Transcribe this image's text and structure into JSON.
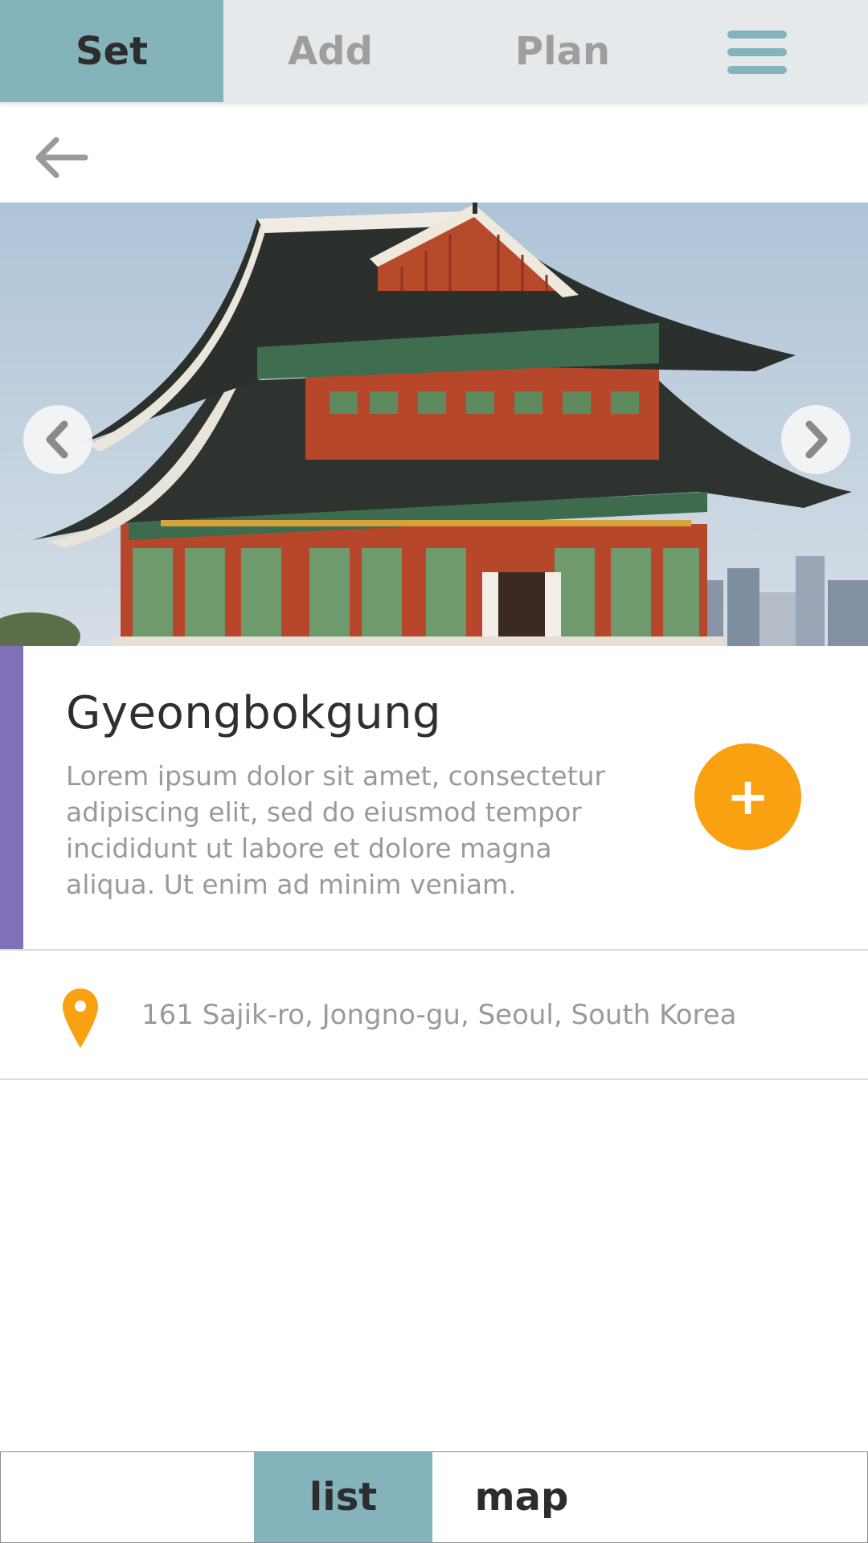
{
  "tabs": {
    "set": "Set",
    "add": "Add",
    "plan": "Plan"
  },
  "icons": {
    "menu": "hamburger-menu-icon",
    "back": "arrow-left-icon",
    "prev": "chevron-left-icon",
    "next": "chevron-right-icon",
    "add": "plus-icon",
    "location": "map-pin-icon"
  },
  "place": {
    "title": "Gyeongbokgung",
    "description": "Lorem ipsum dolor sit amet, consectetur adipiscing elit, sed do eiusmod tempor incididunt ut labore et dolore magna aliqua. Ut enim ad minim veniam.",
    "address": "161 Sajik-ro, Jongno-gu, Seoul, South Korea",
    "add_label": "+"
  },
  "view_toggle": {
    "list": "list",
    "map": "map",
    "selected": "list"
  },
  "colors": {
    "accent_teal": "#84b3bb",
    "accent_purple": "#8070b8",
    "accent_orange": "#f9a110"
  }
}
